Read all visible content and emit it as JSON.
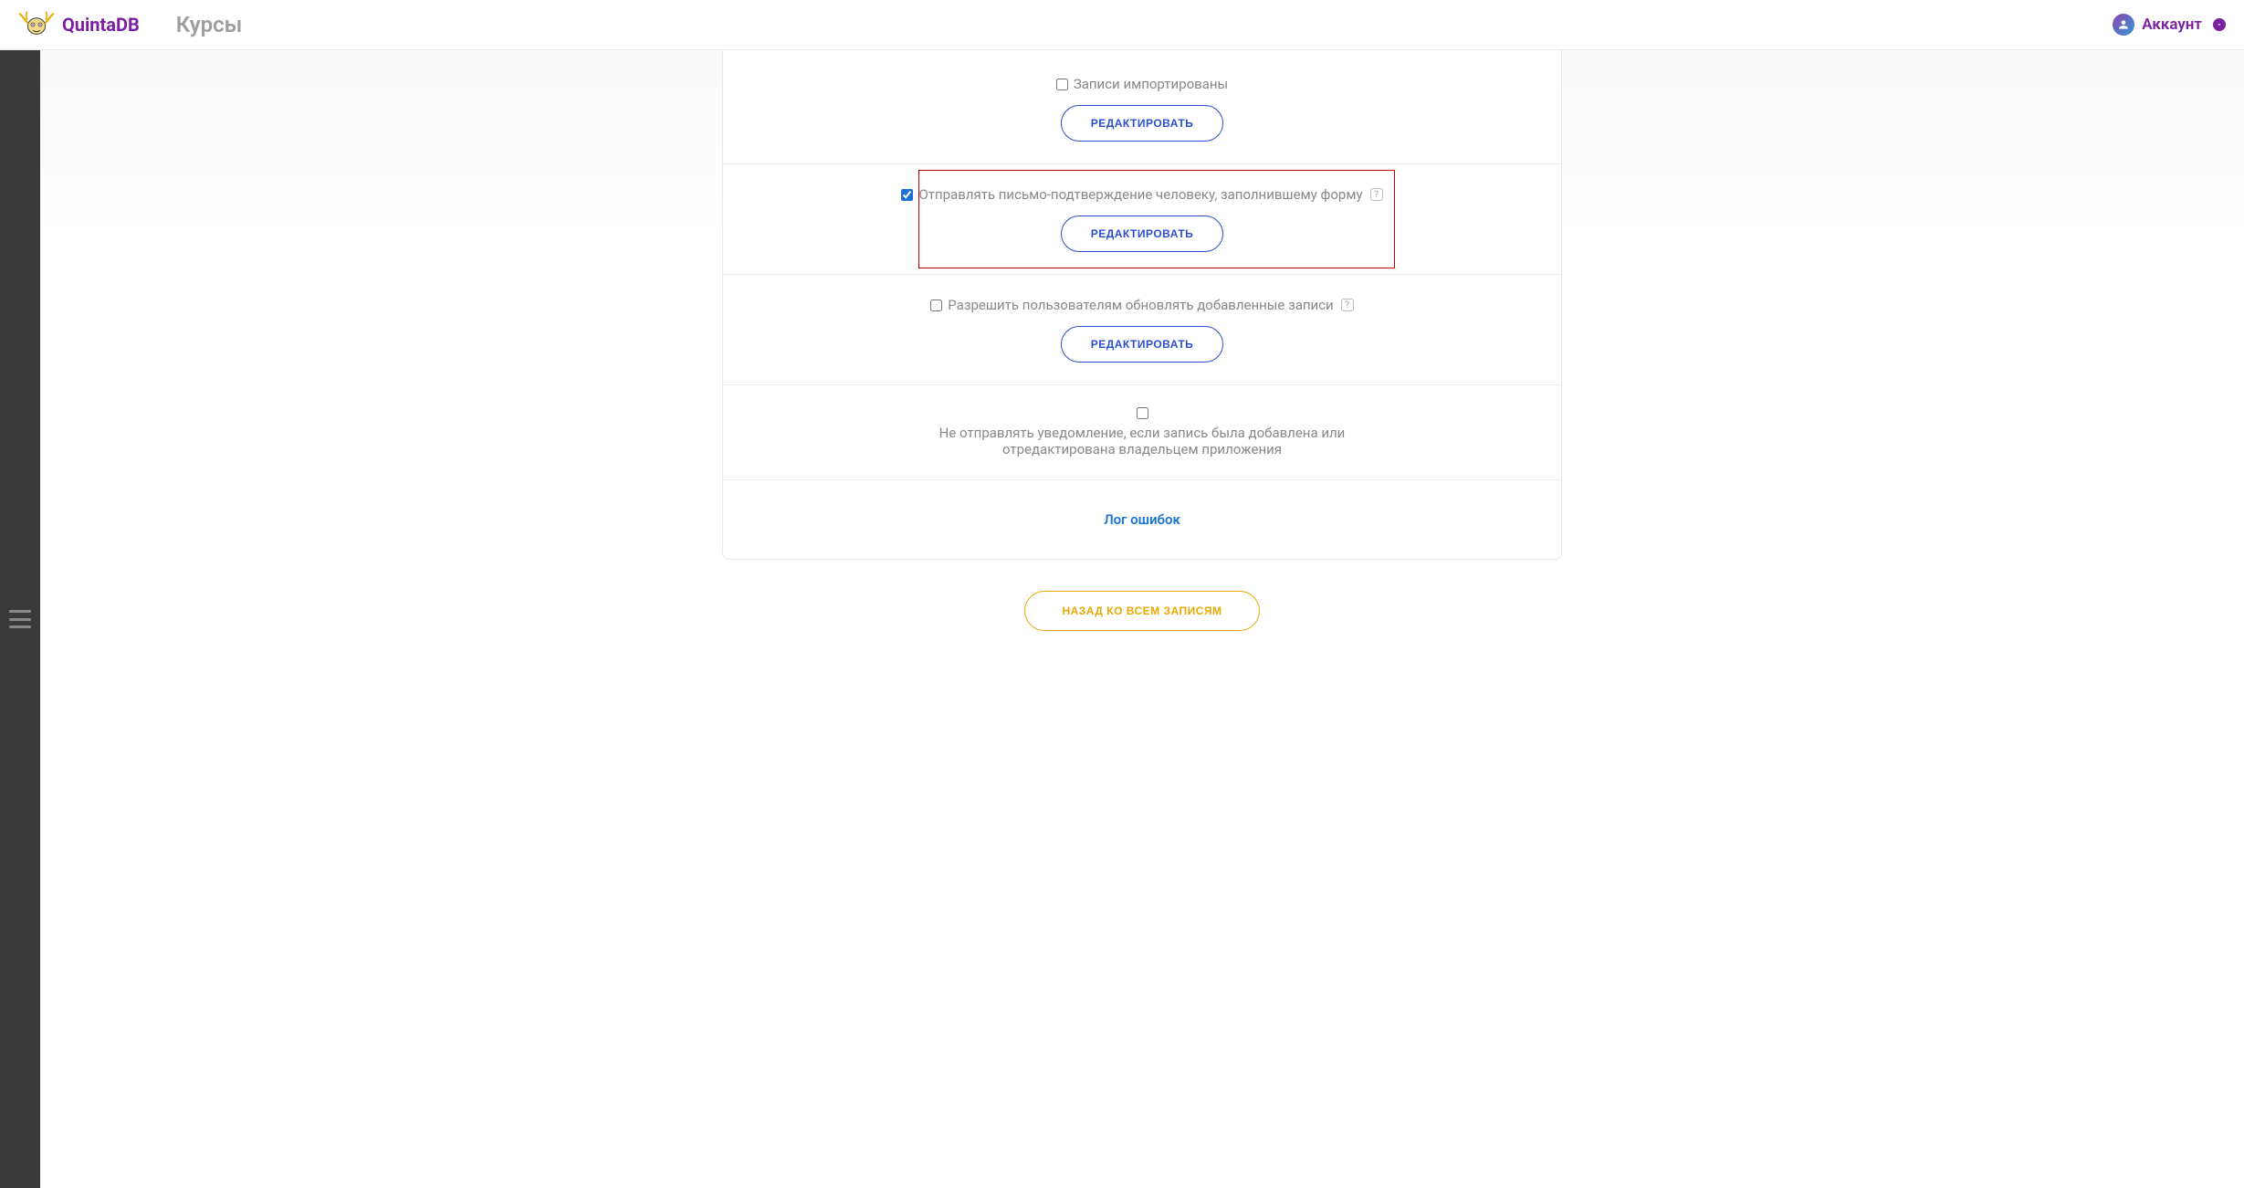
{
  "header": {
    "logo_text": "QuintaDB",
    "breadcrumb": "Курсы",
    "account_label": "Аккаунт"
  },
  "sections": {
    "imported": {
      "label": "Записи импортированы",
      "checked": false,
      "edit_label": "РЕДАКТИРОВАТЬ"
    },
    "confirmation": {
      "label": "Отправлять письмо-подтверждение человеку, заполнившему форму",
      "checked": true,
      "edit_label": "РЕДАКТИРОВАТЬ",
      "help": "?"
    },
    "allow_update": {
      "label": "Разрешить пользователям обновлять добавленные записи",
      "checked": false,
      "edit_label": "РЕДАКТИРОВАТЬ",
      "help": "?"
    },
    "no_notify": {
      "label": "Не отправлять уведомление, если запись была добавлена или отредактирована владельцем приложения",
      "checked": false
    }
  },
  "error_log_label": "Лог ошибок",
  "back_button_label": "НАЗАД КО ВСЕМ ЗАПИСЯМ"
}
